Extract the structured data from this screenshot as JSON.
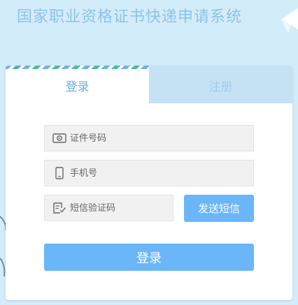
{
  "header": {
    "title": "国家职业资格证书快递申请系统"
  },
  "tabs": {
    "login": "登录",
    "register": "注册"
  },
  "form": {
    "id_number": {
      "placeholder": "证件号码",
      "icon": "id-card-icon"
    },
    "phone": {
      "placeholder": "手机号",
      "icon": "mobile-phone-icon"
    },
    "sms_code": {
      "placeholder": "短信验证码",
      "icon": "sms-code-icon"
    },
    "send_sms_label": "发送短信",
    "submit_label": "登录"
  },
  "colors": {
    "background": "#d3ecf9",
    "accent": "#6ab6f9",
    "tab_active_text": "#6aaee0",
    "tab_inactive_bg": "#c5e2f5"
  }
}
